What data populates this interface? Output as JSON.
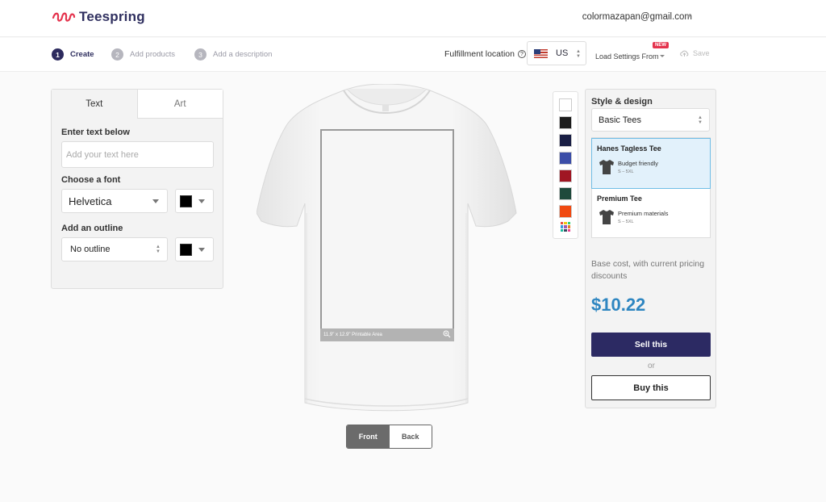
{
  "header": {
    "brand": "Teespring",
    "account_email": "colormazapan@gmail.com"
  },
  "steps": [
    {
      "number": "1",
      "label": "Create"
    },
    {
      "number": "2",
      "label": "Add products"
    },
    {
      "number": "3",
      "label": "Add a description"
    }
  ],
  "toolbar": {
    "fulfillment_label": "Fulfillment location",
    "help_glyph": "?",
    "country": "US",
    "load_settings_label": "Load Settings From",
    "new_badge": "NEW",
    "save_label": "Save"
  },
  "editor": {
    "tabs": [
      "Text",
      "Art"
    ],
    "enter_text_label": "Enter text below",
    "text_placeholder": "Add your text here",
    "font_label": "Choose a font",
    "font_value": "Helvetica",
    "outline_label": "Add an outline",
    "outline_value": "No outline",
    "font_color": "#000000",
    "outline_color": "#000000"
  },
  "canvas": {
    "printable_area": "11.9\" x 12.9\" Printable Area",
    "views": [
      "Front",
      "Back"
    ],
    "active_view": "Front"
  },
  "shirt_colors": [
    "#ffffff",
    "#1c1c1c",
    "#1a1f45",
    "#3c4ea8",
    "#a01623",
    "#1f4a3c",
    "#f04a12"
  ],
  "style": {
    "title": "Style & design",
    "style_value": "Basic Tees",
    "products": [
      {
        "name": "Hanes Tagless Tee",
        "desc": "Budget friendly",
        "sizes": "S – 5XL"
      },
      {
        "name": "Premium Tee",
        "desc": "Premium materials",
        "sizes": "S – 5XL"
      }
    ],
    "cost_label": "Base cost, with current pricing discounts",
    "price": "$10.22",
    "sell_label": "Sell this",
    "or_label": "or",
    "buy_label": "Buy this"
  }
}
